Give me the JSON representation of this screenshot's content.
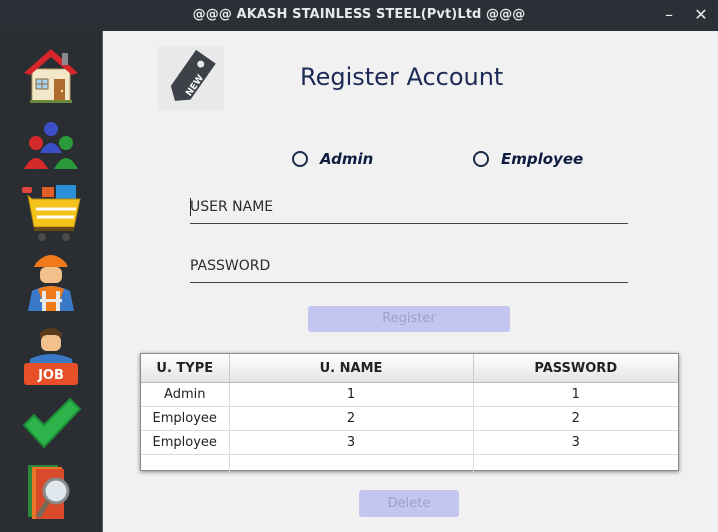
{
  "window": {
    "title": "@@@ AKASH STAINLESS STEEL(Pvt)Ltd @@@",
    "minimize_glyph": "–",
    "close_glyph": "✕"
  },
  "sidebar": {
    "items": [
      {
        "icon": "home-icon"
      },
      {
        "icon": "users-icon"
      },
      {
        "icon": "shopping-cart-icon"
      },
      {
        "icon": "worker-icon"
      },
      {
        "icon": "job-icon"
      },
      {
        "icon": "checkmark-icon"
      },
      {
        "icon": "search-report-icon"
      }
    ]
  },
  "form": {
    "tag_icon_text": "NEW",
    "heading": "Register Account",
    "radio_admin": "Admin",
    "radio_employee": "Employee",
    "username_placeholder": "USER NAME",
    "password_placeholder": "PASSWORD",
    "register_label": "Register",
    "delete_label": "Delete"
  },
  "table": {
    "headers": [
      "U. TYPE",
      "U. NAME",
      "PASSWORD"
    ],
    "rows": [
      [
        "Admin",
        "1",
        "1"
      ],
      [
        "Employee",
        "2",
        "2"
      ],
      [
        "Employee",
        "3",
        "3"
      ]
    ]
  },
  "colors": {
    "sidebar_bg": "#2a2e33",
    "content_bg": "#f1f1f1",
    "heading": "#1d2a55",
    "button_disabled": "#c3c6f1"
  }
}
